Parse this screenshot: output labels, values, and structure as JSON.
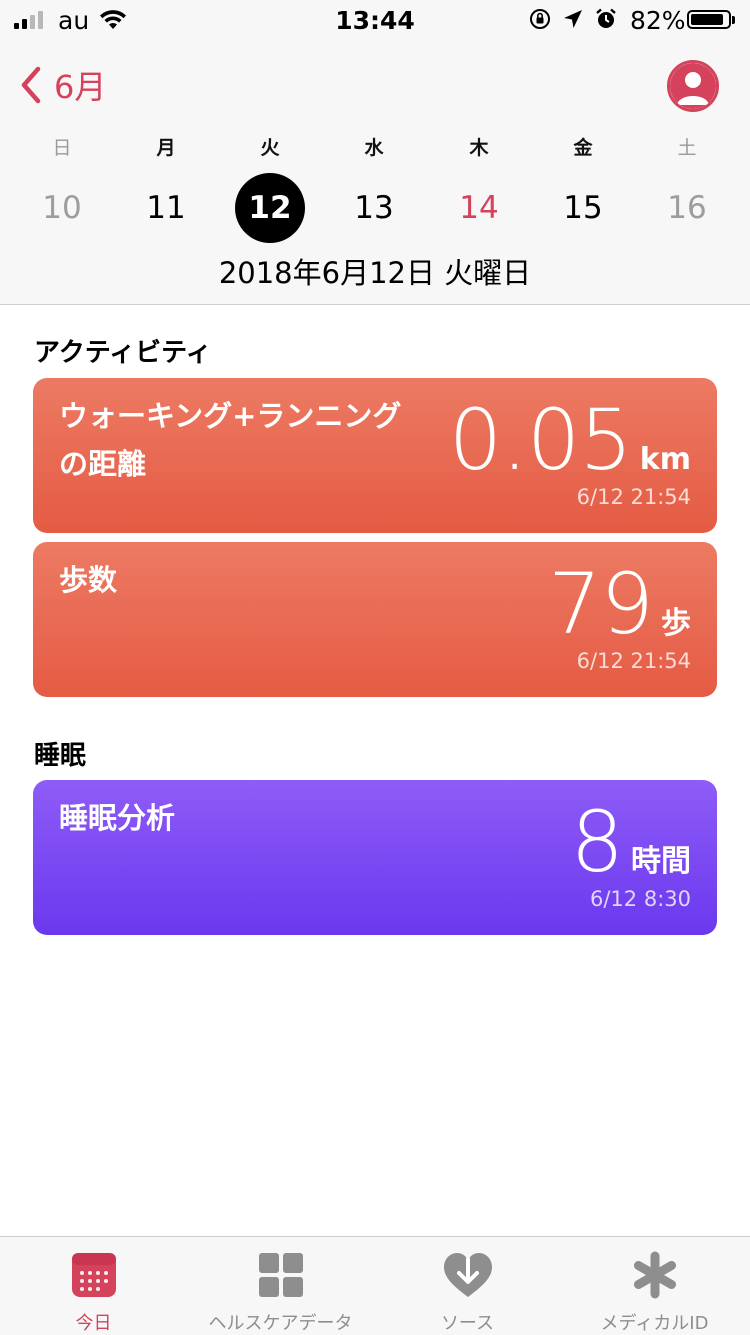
{
  "status_bar": {
    "carrier": "au",
    "time": "13:44",
    "battery_percent": "82%",
    "battery_level": 0.82
  },
  "nav": {
    "back_label": "6月"
  },
  "calendar": {
    "weekdays": [
      "日",
      "月",
      "火",
      "水",
      "木",
      "金",
      "土"
    ],
    "days": [
      "10",
      "11",
      "12",
      "13",
      "14",
      "15",
      "16"
    ],
    "selected_index": 2,
    "today_index": 4,
    "full_date": "2018年6月12日 火曜日"
  },
  "colors": {
    "accent": "#d4435b",
    "activity_card": "#e8654e",
    "sleep_card": "#7b48f2"
  },
  "sections": {
    "activity_title": "アクティビティ",
    "sleep_title": "睡眠"
  },
  "cards": {
    "distance": {
      "label_line1": "ウォーキング+ランニング",
      "label_line2": "の距離",
      "value": "0.05",
      "unit": "km",
      "timestamp": "6/12 21:54"
    },
    "steps": {
      "label": "歩数",
      "value": "79",
      "unit": "歩",
      "timestamp": "6/12 21:54"
    },
    "sleep": {
      "label": "睡眠分析",
      "value": "8",
      "unit": "時間",
      "timestamp": "6/12 8:30"
    }
  },
  "tabs": [
    {
      "label": "今日",
      "icon": "calendar-today-icon",
      "active": true
    },
    {
      "label": "ヘルスケアデータ",
      "icon": "grid-icon",
      "active": false
    },
    {
      "label": "ソース",
      "icon": "heart-download-icon",
      "active": false
    },
    {
      "label": "メディカルID",
      "icon": "asterisk-icon",
      "active": false
    }
  ]
}
